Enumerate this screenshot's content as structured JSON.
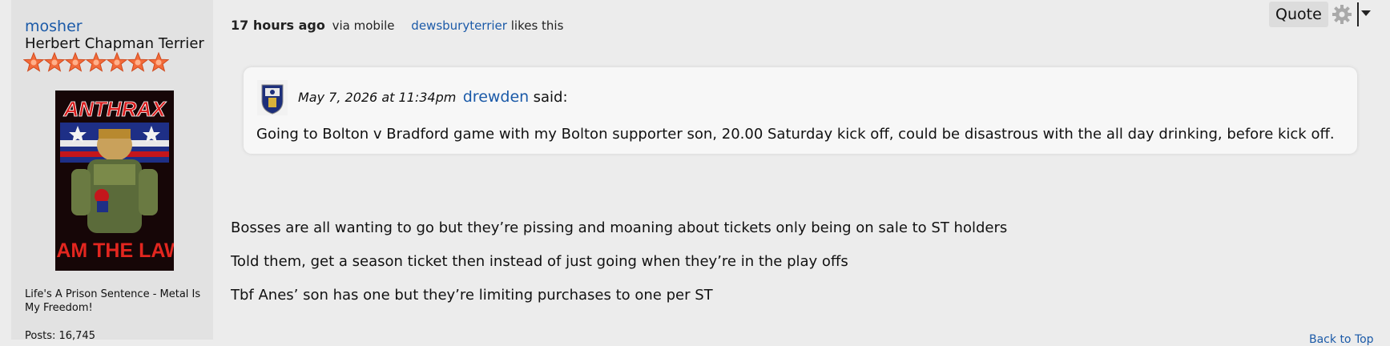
{
  "user": {
    "username": "mosher",
    "title": "Herbert Chapman Terrier",
    "star_count": 7,
    "avatar": {
      "top_text": "ANTHRAX",
      "bottom_text": "I AM THE LAW"
    },
    "signature": "Life's A Prison Sentence - Metal Is My Freedom!",
    "posts": "Posts: 16,745"
  },
  "post": {
    "time": "17 hours ago",
    "via": "via mobile",
    "liker": "dewsburyterrier",
    "likes_suffix": "likes this",
    "quote_button": "Quote",
    "quote": {
      "date": "May 7, 2026 at 11:34pm",
      "author": "drewden",
      "said": "said:",
      "text": "Going to Bolton v Bradford game with my Bolton supporter son, 20.00 Saturday kick off, could be disastrous with the all day drinking, before kick off."
    },
    "paragraphs": [
      "Bosses are all wanting to go but they’re pissing and moaning about tickets only being on sale to ST holders",
      "Told them, get a season ticket then instead of just going when they’re in the play offs",
      "Tbf Anes’ son has one but they’re limiting purchases to one per ST"
    ],
    "back_link": "Back to Top"
  },
  "colors": {
    "link": "#1b5aa8",
    "star": "#f26b3a",
    "background": "#ececec",
    "sidebar": "#e2e2e2"
  },
  "icons": [
    "star-icon",
    "gear-icon",
    "dropdown-arrow-icon",
    "club-crest-icon"
  ]
}
